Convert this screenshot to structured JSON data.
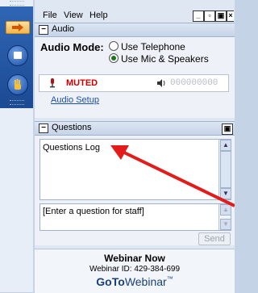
{
  "menu": {
    "file": "File",
    "view": "View",
    "help": "Help"
  },
  "audio": {
    "section_title": "Audio",
    "mode_label": "Audio Mode:",
    "options": [
      {
        "label": "Use Telephone",
        "selected": false
      },
      {
        "label": "Use Mic & Speakers",
        "selected": true
      }
    ],
    "mute_status": "MUTED",
    "volume_digits": "000000000",
    "setup_link": "Audio Setup"
  },
  "questions": {
    "section_title": "Questions",
    "log_text": "Questions Log",
    "input_placeholder": "[Enter a question for staff]",
    "send_label": "Send"
  },
  "footer": {
    "title": "Webinar Now",
    "webinar_id": "Webinar ID: 429-384-699",
    "brand_goto": "GoTo",
    "brand_webinar": "Webinar",
    "brand_tm": "™"
  },
  "colors": {
    "accent": "#2f66b5",
    "muted": "#cc0000",
    "arrow": "#e21b1b",
    "link": "#1a4fb0"
  },
  "icons": [
    "arrow-right-icon",
    "screen-icon",
    "hand-raise-icon",
    "microphone-icon",
    "speaker-icon",
    "window-minimize-icon",
    "window-restore-icon",
    "popout-icon",
    "close-icon",
    "collapse-icon"
  ]
}
